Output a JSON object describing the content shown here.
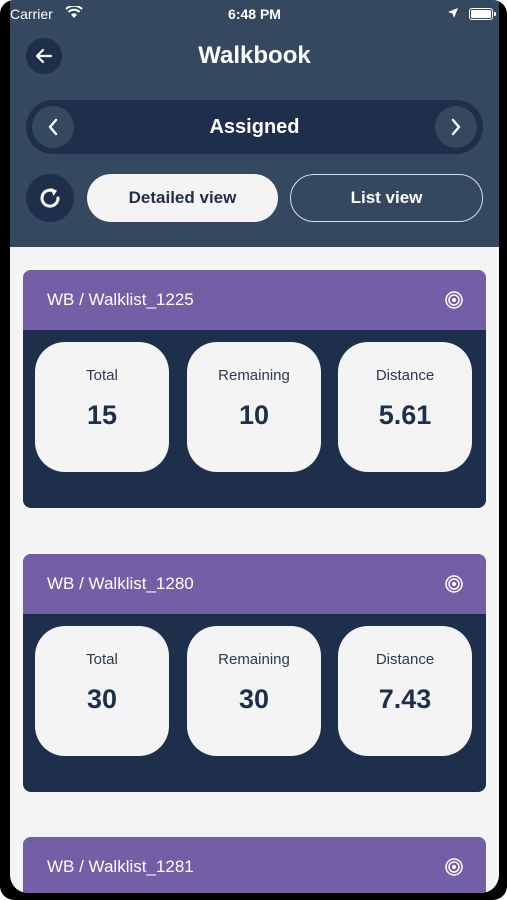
{
  "status_bar": {
    "carrier": "Carrier",
    "time": "6:48 PM"
  },
  "header": {
    "title": "Walkbook"
  },
  "pager": {
    "label": "Assigned"
  },
  "view_toggle": {
    "detailed_label": "Detailed view",
    "list_label": "List view",
    "selected": "Detailed view"
  },
  "colors": {
    "header_bg": "#34495f",
    "card_bg": "#1e2f4b",
    "card_header": "#735fa6",
    "stat_bg": "#f4f4f4"
  },
  "walklists": [
    {
      "title": "WB /  Walklist_1225",
      "total_label": "Total",
      "total": "15",
      "remaining_label": "Remaining",
      "remaining": "10",
      "distance_label": "Distance",
      "distance": "5.61"
    },
    {
      "title": "WB /  Walklist_1280",
      "total_label": "Total",
      "total": "30",
      "remaining_label": "Remaining",
      "remaining": "30",
      "distance_label": "Distance",
      "distance": "7.43"
    },
    {
      "title": "WB /  Walklist_1281"
    }
  ]
}
